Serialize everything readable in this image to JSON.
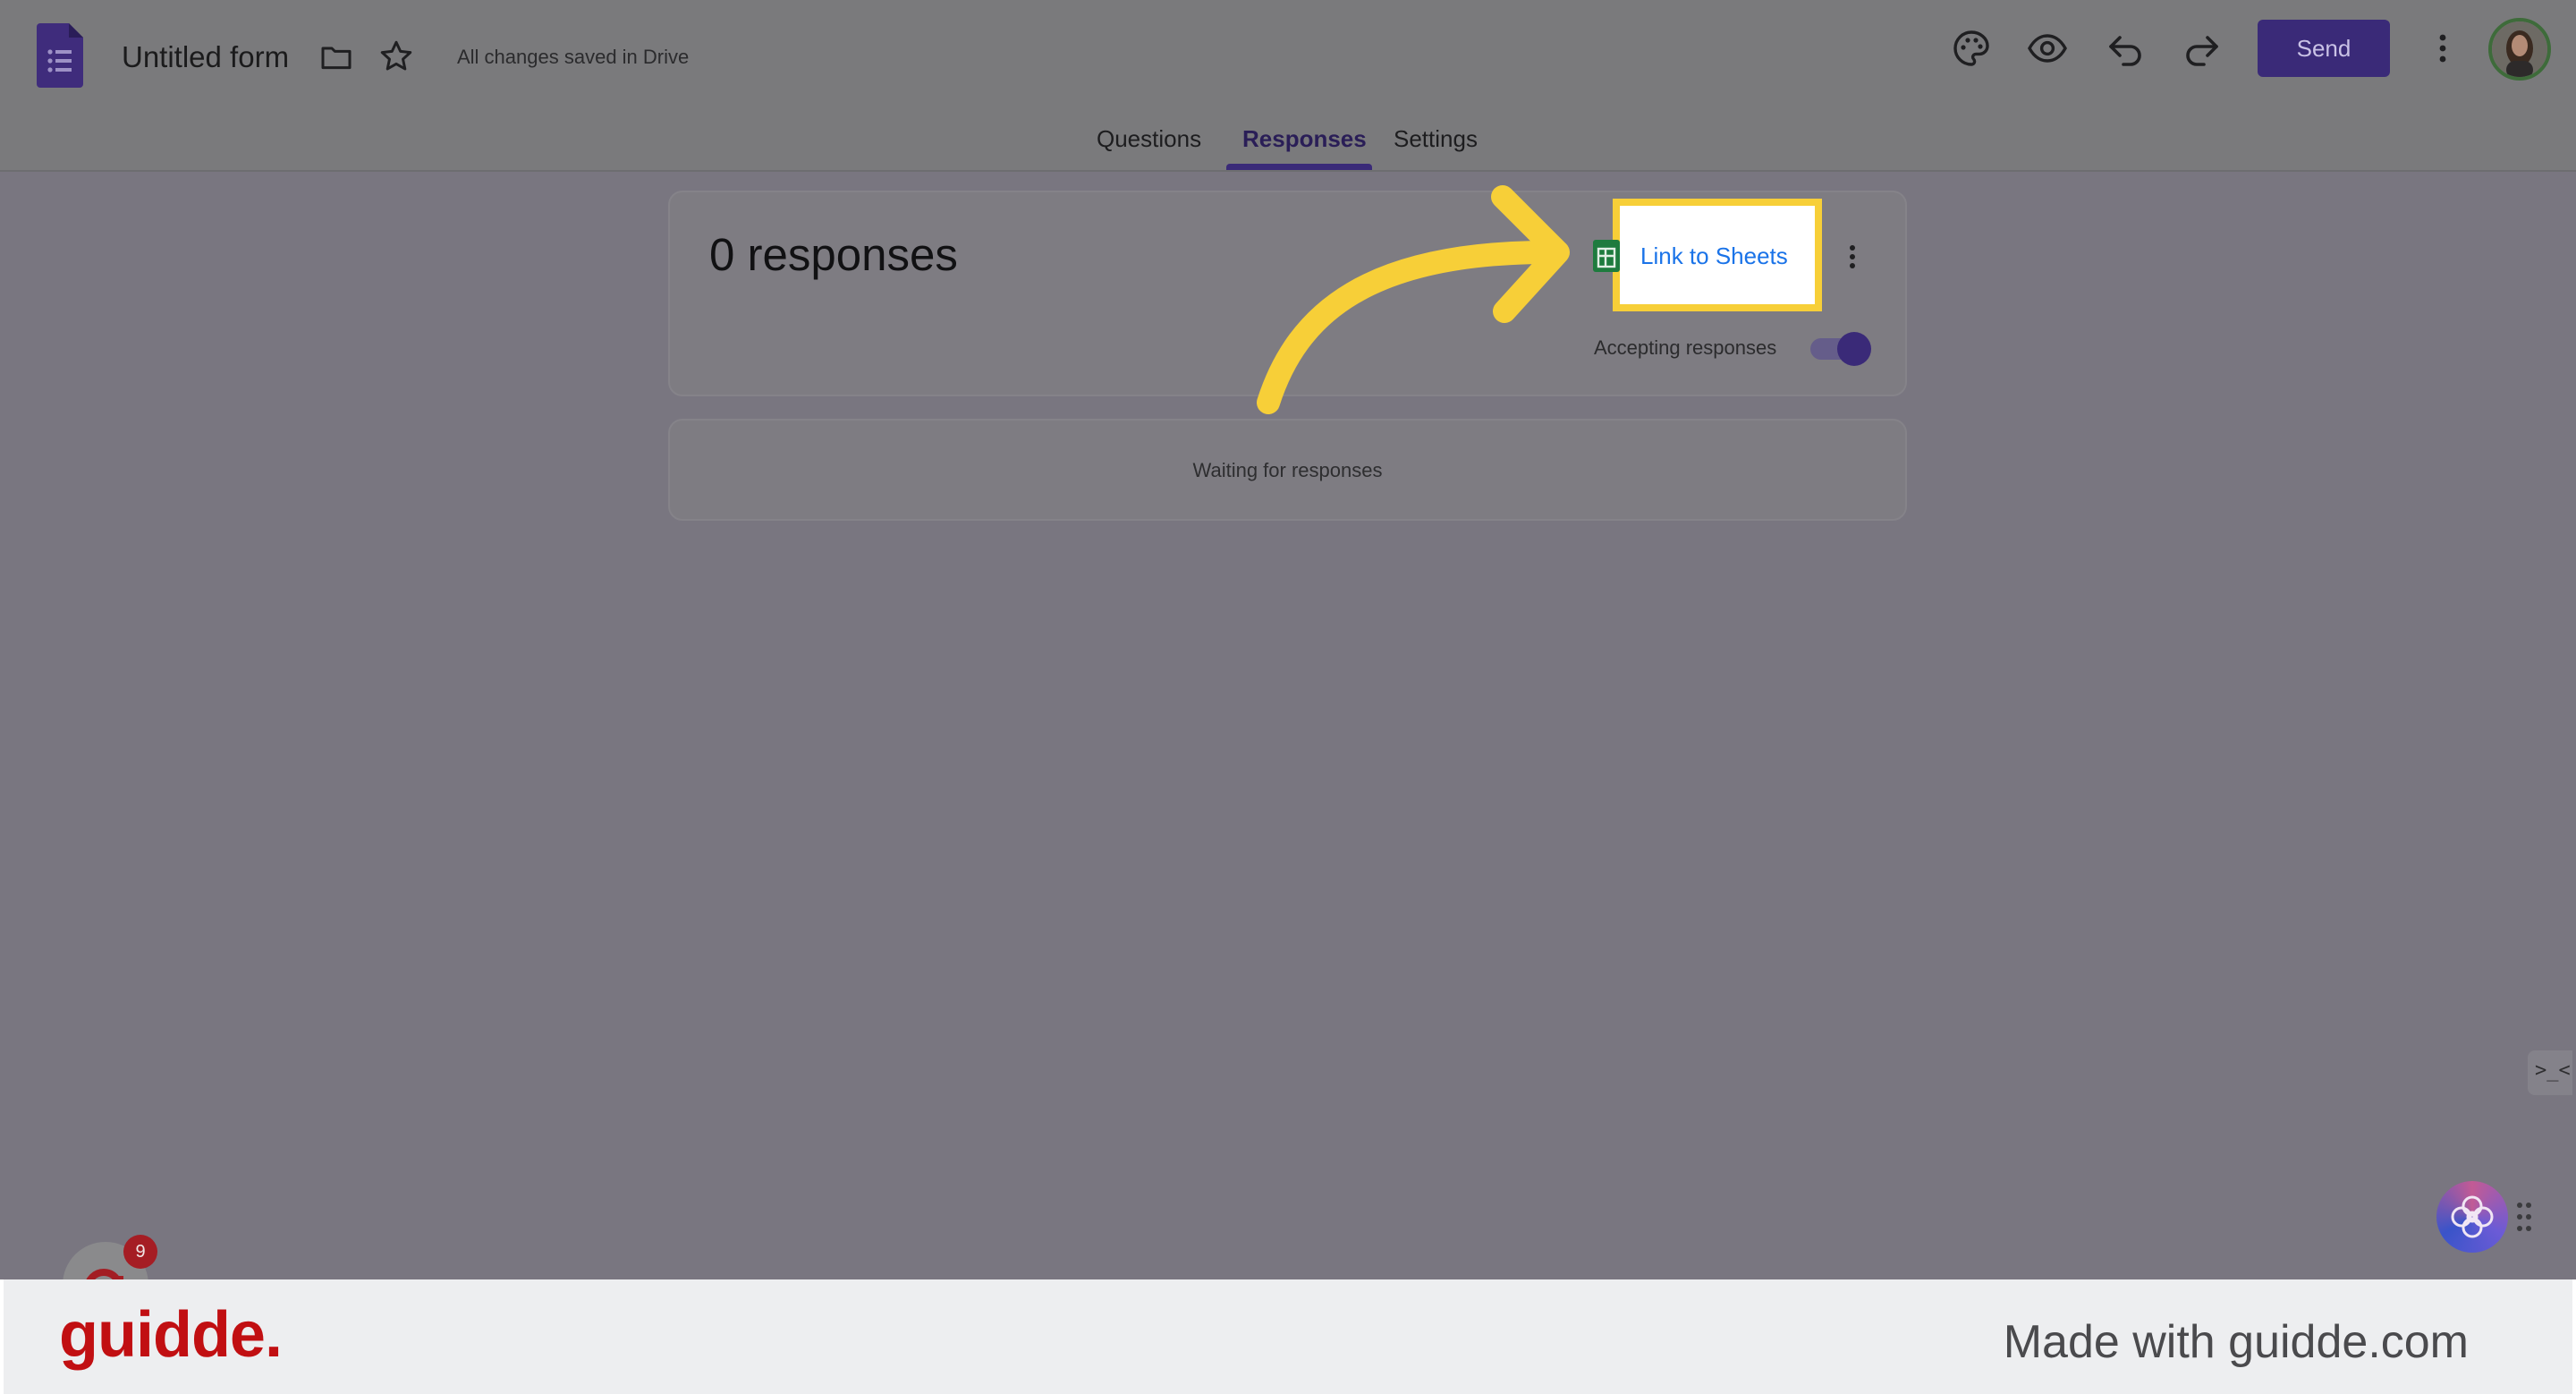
{
  "header": {
    "form_title": "Untitled form",
    "save_status": "All changes saved in Drive",
    "send_label": "Send",
    "icons": [
      "forms-logo-icon",
      "folder-icon",
      "star-icon",
      "palette-icon",
      "preview-eye-icon",
      "undo-icon",
      "redo-icon",
      "more-vert-icon"
    ]
  },
  "tabs": [
    {
      "label": "Questions",
      "active": false
    },
    {
      "label": "Responses",
      "active": true
    },
    {
      "label": "Settings",
      "active": false
    }
  ],
  "responses_card": {
    "count_label": "0 responses",
    "link_label": "Link to Sheets",
    "accepting_label": "Accepting responses",
    "accepting": true
  },
  "waiting_card": {
    "message": "Waiting for responses"
  },
  "widgets": {
    "notification_count": "9",
    "side_expand_glyph": ">_<"
  },
  "footer": {
    "logo_text": "guidde.",
    "made_with": "Made with guidde.com"
  },
  "colors": {
    "accent": "#3a2a78",
    "highlight": "#f7cf38",
    "link": "#1a73e8",
    "brand_red": "#c10f12"
  }
}
